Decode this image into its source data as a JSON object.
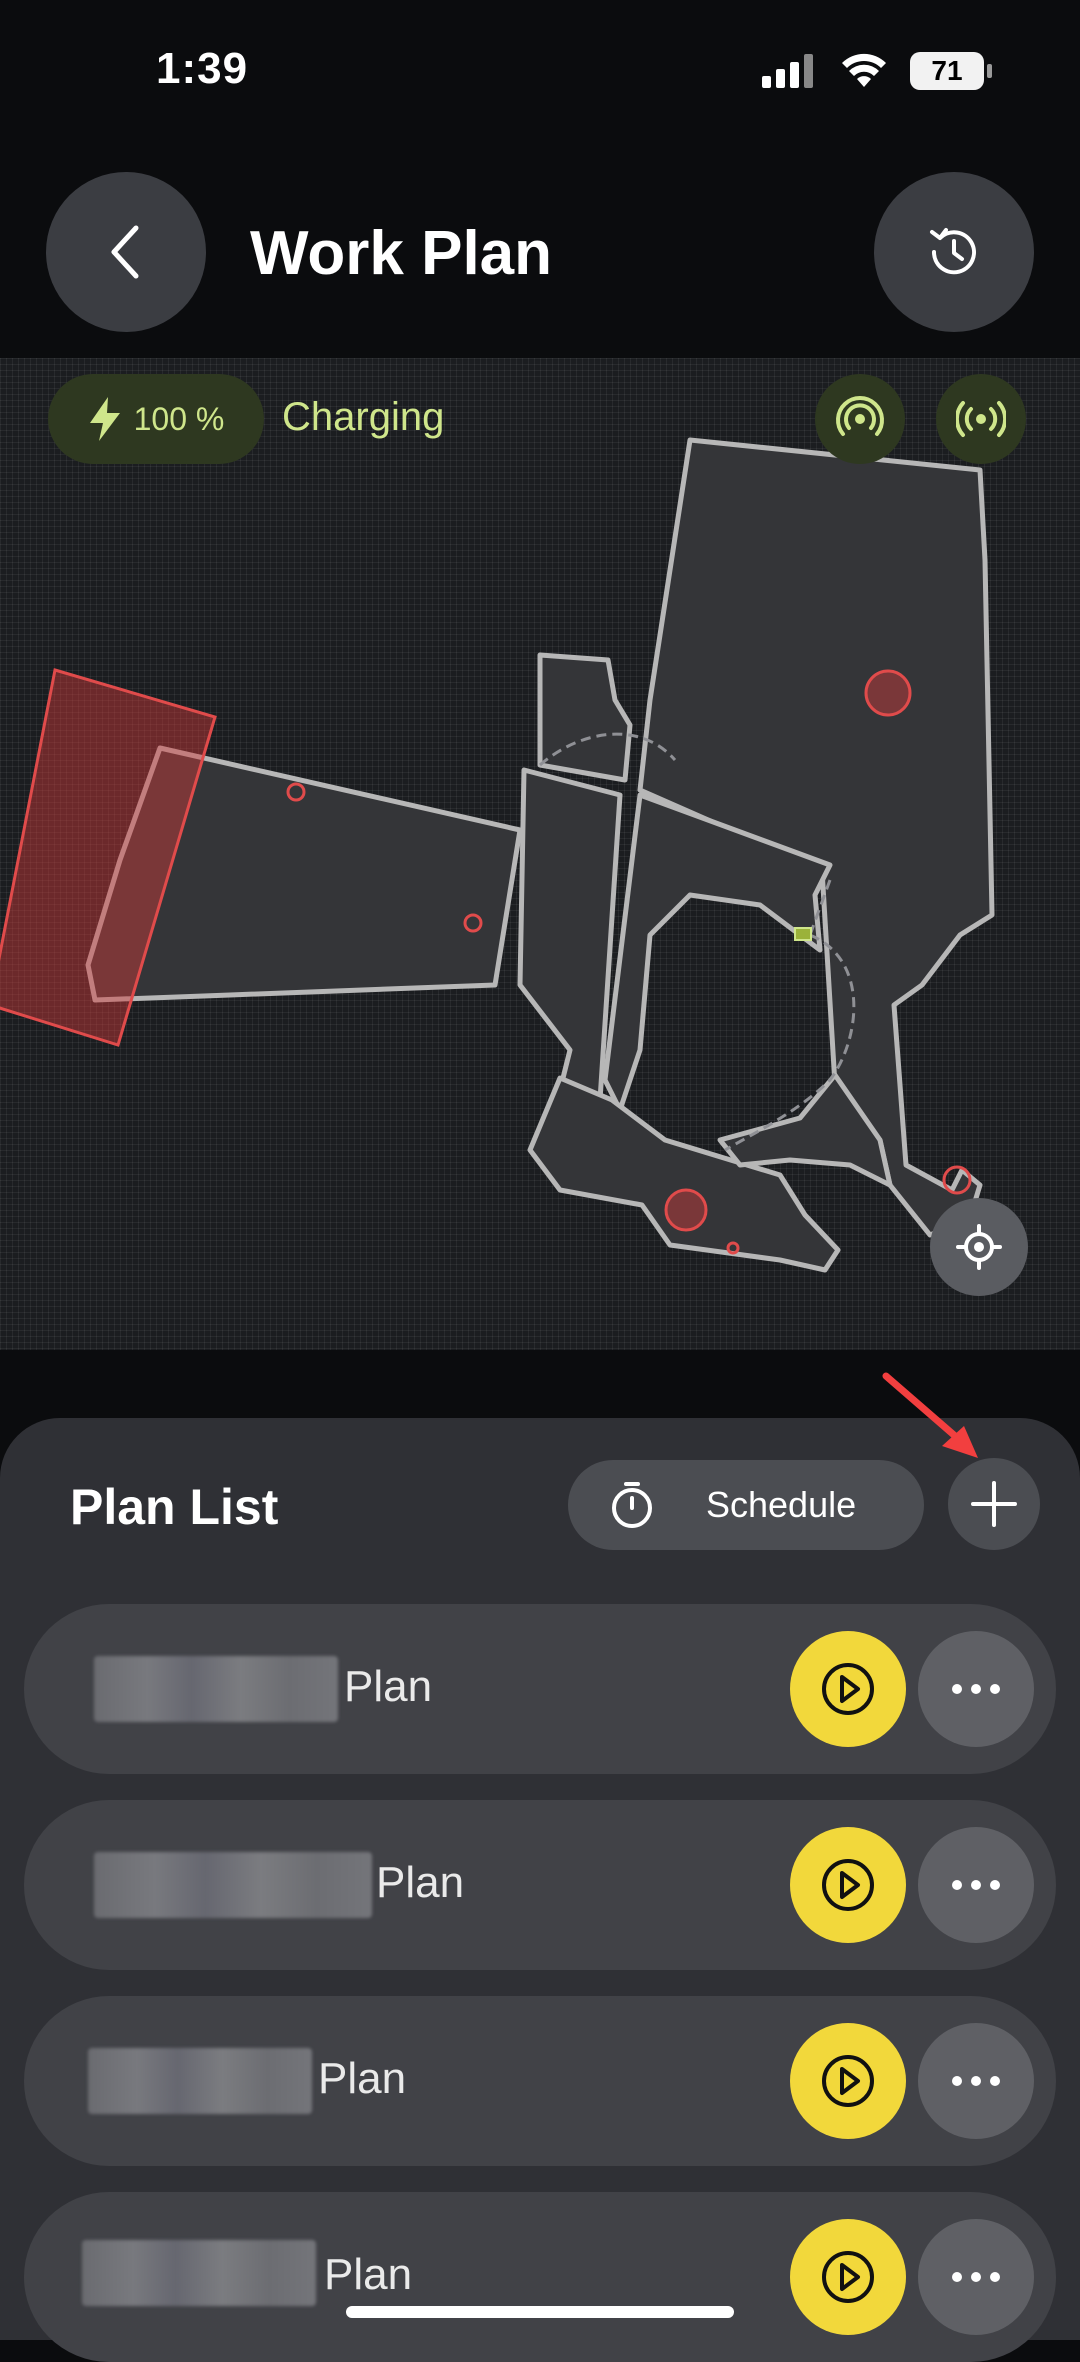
{
  "status_bar": {
    "time": "1:39",
    "battery_level": "71"
  },
  "header": {
    "title": "Work Plan",
    "back_icon": "chevron-left-icon",
    "history_icon": "history-icon"
  },
  "map": {
    "battery_label": "100 %",
    "charging_label": "Charging",
    "accent_color": "#cfe68b",
    "boundary_color": "#b7b7b7",
    "no_go_zone_color": "#e04b4b"
  },
  "panel": {
    "title": "Plan List",
    "schedule_label": "Schedule",
    "add_icon": "plus-icon"
  },
  "plans": [
    {
      "label": "Plan"
    },
    {
      "label": "Plan"
    },
    {
      "label": "Plan"
    },
    {
      "label": "Plan"
    }
  ],
  "colors": {
    "play_button": "#f2d83b",
    "background": "#0b0c0e",
    "panel": "#2f3035"
  }
}
